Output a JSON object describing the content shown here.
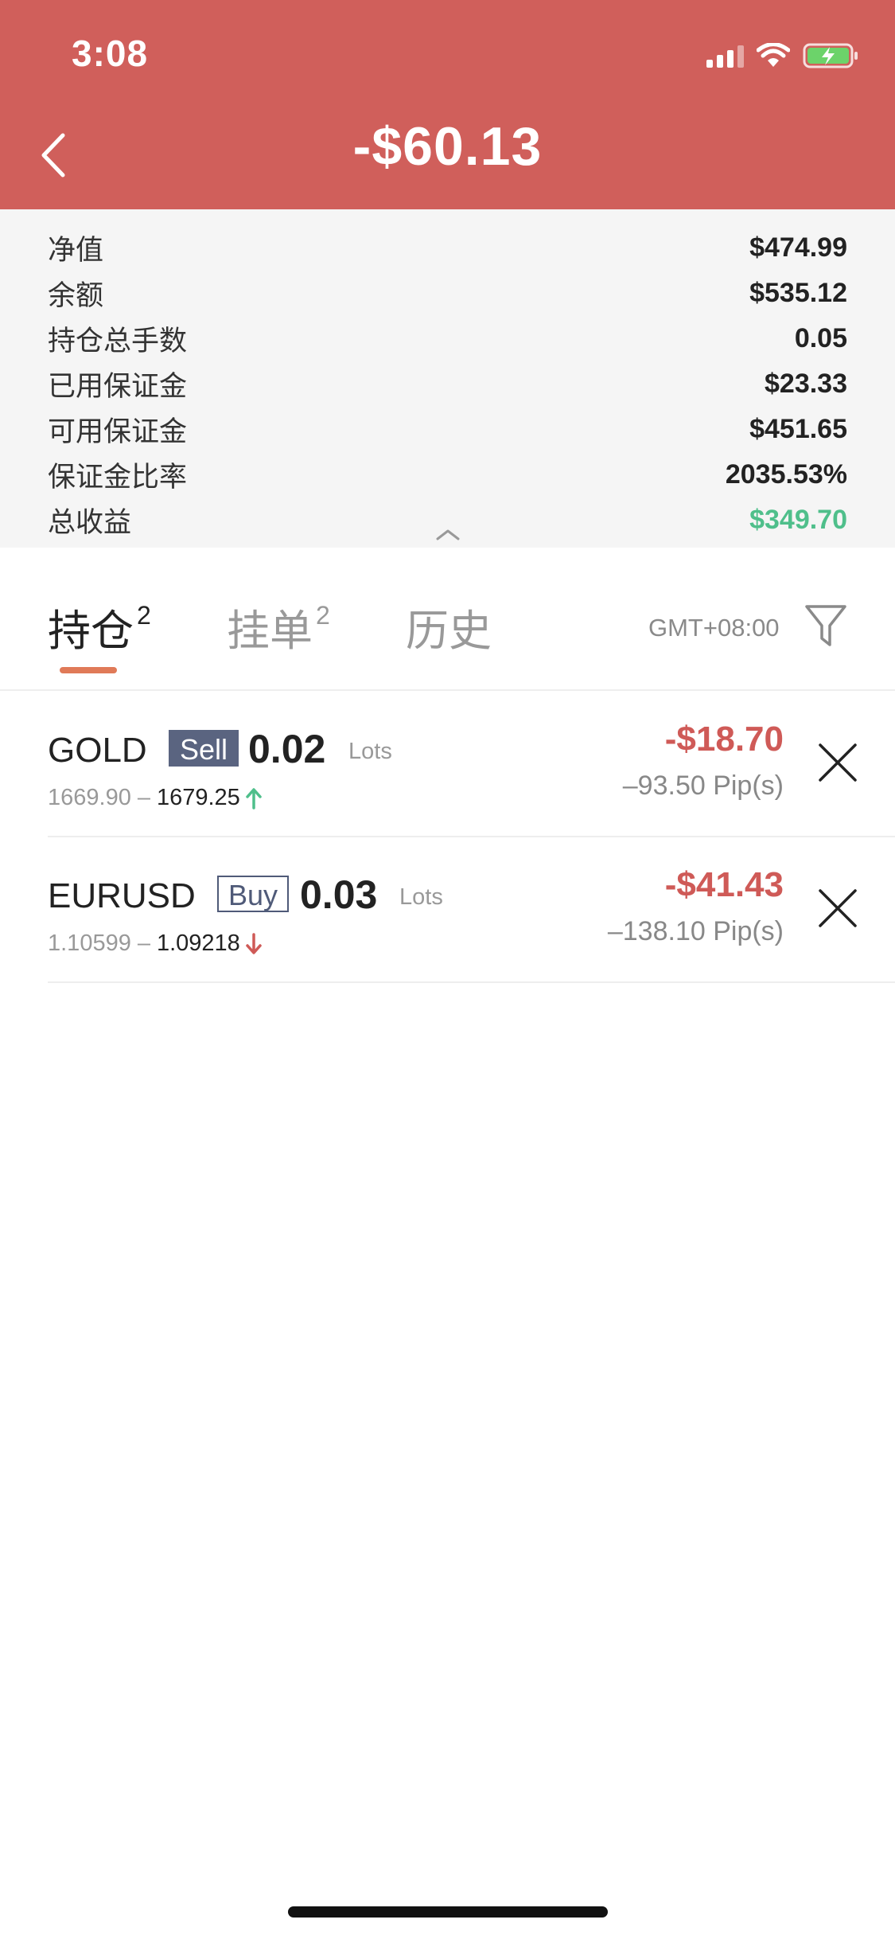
{
  "status_bar": {
    "time": "3:08",
    "icons": [
      "cellular-signal-icon",
      "wifi-icon",
      "battery-charging-icon"
    ]
  },
  "header": {
    "title": "-$60.13",
    "back_icon": "chevron-left-icon",
    "background_color": "#d05f5b"
  },
  "summary": {
    "rows": [
      {
        "label": "净值",
        "value": "$474.99"
      },
      {
        "label": "余额",
        "value": "$535.12"
      },
      {
        "label": "持仓总手数",
        "value": "0.05"
      },
      {
        "label": "已用保证金",
        "value": "$23.33"
      },
      {
        "label": "可用保证金",
        "value": "$451.65"
      },
      {
        "label": "保证金比率",
        "value": "2035.53%"
      },
      {
        "label": "总收益",
        "value": "$349.70"
      }
    ],
    "collapse_icon": "chevron-up-icon"
  },
  "tabs": {
    "items": [
      {
        "label": "持仓",
        "count": "2"
      },
      {
        "label": "挂单",
        "count": "2"
      },
      {
        "label": "历史",
        "count": ""
      }
    ],
    "active_index": 0,
    "timezone": "GMT+08:00",
    "filter_icon": "filter-icon"
  },
  "positions": [
    {
      "symbol": "GOLD",
      "side": "Sell",
      "lots": "0.02",
      "lots_label": "Lots",
      "open_price": "1669.90",
      "separator": "–",
      "current_price": "1679.25",
      "direction": "up",
      "pnl": "-$18.70",
      "pips": "–93.50 Pip(s)"
    },
    {
      "symbol": "EURUSD",
      "side": "Buy",
      "lots": "0.03",
      "lots_label": "Lots",
      "open_price": "1.10599",
      "separator": "–",
      "current_price": "1.09218",
      "direction": "down",
      "pnl": "-$41.43",
      "pips": "–138.10 Pip(s)"
    }
  ],
  "colors": {
    "loss": "#cf5a57",
    "gain": "#4fbf8b",
    "tab_accent": "#e07a58"
  }
}
